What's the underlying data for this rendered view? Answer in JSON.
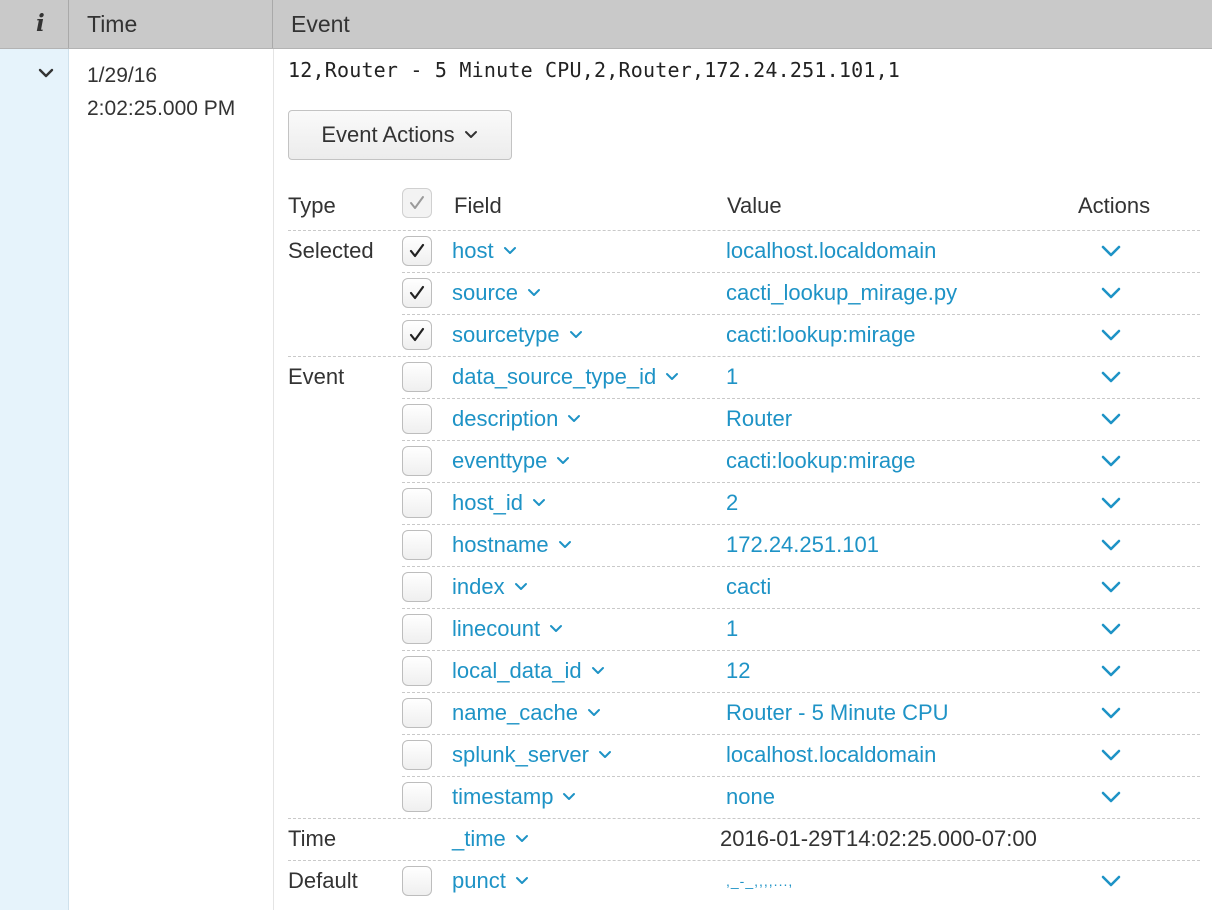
{
  "header": {
    "info_label": "i",
    "time_label": "Time",
    "event_label": "Event"
  },
  "event": {
    "time_date": "1/29/16",
    "time_clock": "2:02:25.000 PM",
    "raw": "12,Router - 5 Minute CPU,2,Router,172.24.251.101,1",
    "actions_button": "Event Actions"
  },
  "table": {
    "col_type": "Type",
    "col_field": "Field",
    "col_value": "Value",
    "col_actions": "Actions",
    "rows": [
      {
        "type": "Selected",
        "checked": true,
        "field": "host",
        "value": "localhost.localdomain",
        "has_action": true
      },
      {
        "type": "",
        "checked": true,
        "field": "source",
        "value": "cacti_lookup_mirage.py",
        "has_action": true
      },
      {
        "type": "",
        "checked": true,
        "field": "sourcetype",
        "value": "cacti:lookup:mirage",
        "has_action": true
      },
      {
        "type": "Event",
        "checked": false,
        "field": "data_source_type_id",
        "value": "1",
        "has_action": true
      },
      {
        "type": "",
        "checked": false,
        "field": "description",
        "value": "Router",
        "has_action": true
      },
      {
        "type": "",
        "checked": false,
        "field": "eventtype",
        "value": "cacti:lookup:mirage",
        "has_action": true
      },
      {
        "type": "",
        "checked": false,
        "field": "host_id",
        "value": "2",
        "has_action": true
      },
      {
        "type": "",
        "checked": false,
        "field": "hostname",
        "value": "172.24.251.101",
        "has_action": true
      },
      {
        "type": "",
        "checked": false,
        "field": "index",
        "value": "cacti",
        "has_action": true
      },
      {
        "type": "",
        "checked": false,
        "field": "linecount",
        "value": "1",
        "has_action": true
      },
      {
        "type": "",
        "checked": false,
        "field": "local_data_id",
        "value": "12",
        "has_action": true
      },
      {
        "type": "",
        "checked": false,
        "field": "name_cache",
        "value": "Router - 5 Minute CPU",
        "has_action": true
      },
      {
        "type": "",
        "checked": false,
        "field": "splunk_server",
        "value": "localhost.localdomain",
        "has_action": true
      },
      {
        "type": "",
        "checked": false,
        "field": "timestamp",
        "value": "none",
        "has_action": true
      },
      {
        "type": "Time",
        "checked": null,
        "field": "_time",
        "value": "2016-01-29T14:02:25.000-07:00",
        "has_action": false
      },
      {
        "type": "Default",
        "checked": false,
        "field": "punct",
        "value": ",_-_,,,,...,",
        "has_action": true
      }
    ]
  },
  "colors": {
    "link": "#1e93c6",
    "header_bg": "#c9c9c9",
    "strip_bg": "#e6f3fb"
  },
  "icons": {
    "expand": "chevron-down-icon",
    "checkbox": "checkmark-icon",
    "action": "chevron-down-icon"
  }
}
